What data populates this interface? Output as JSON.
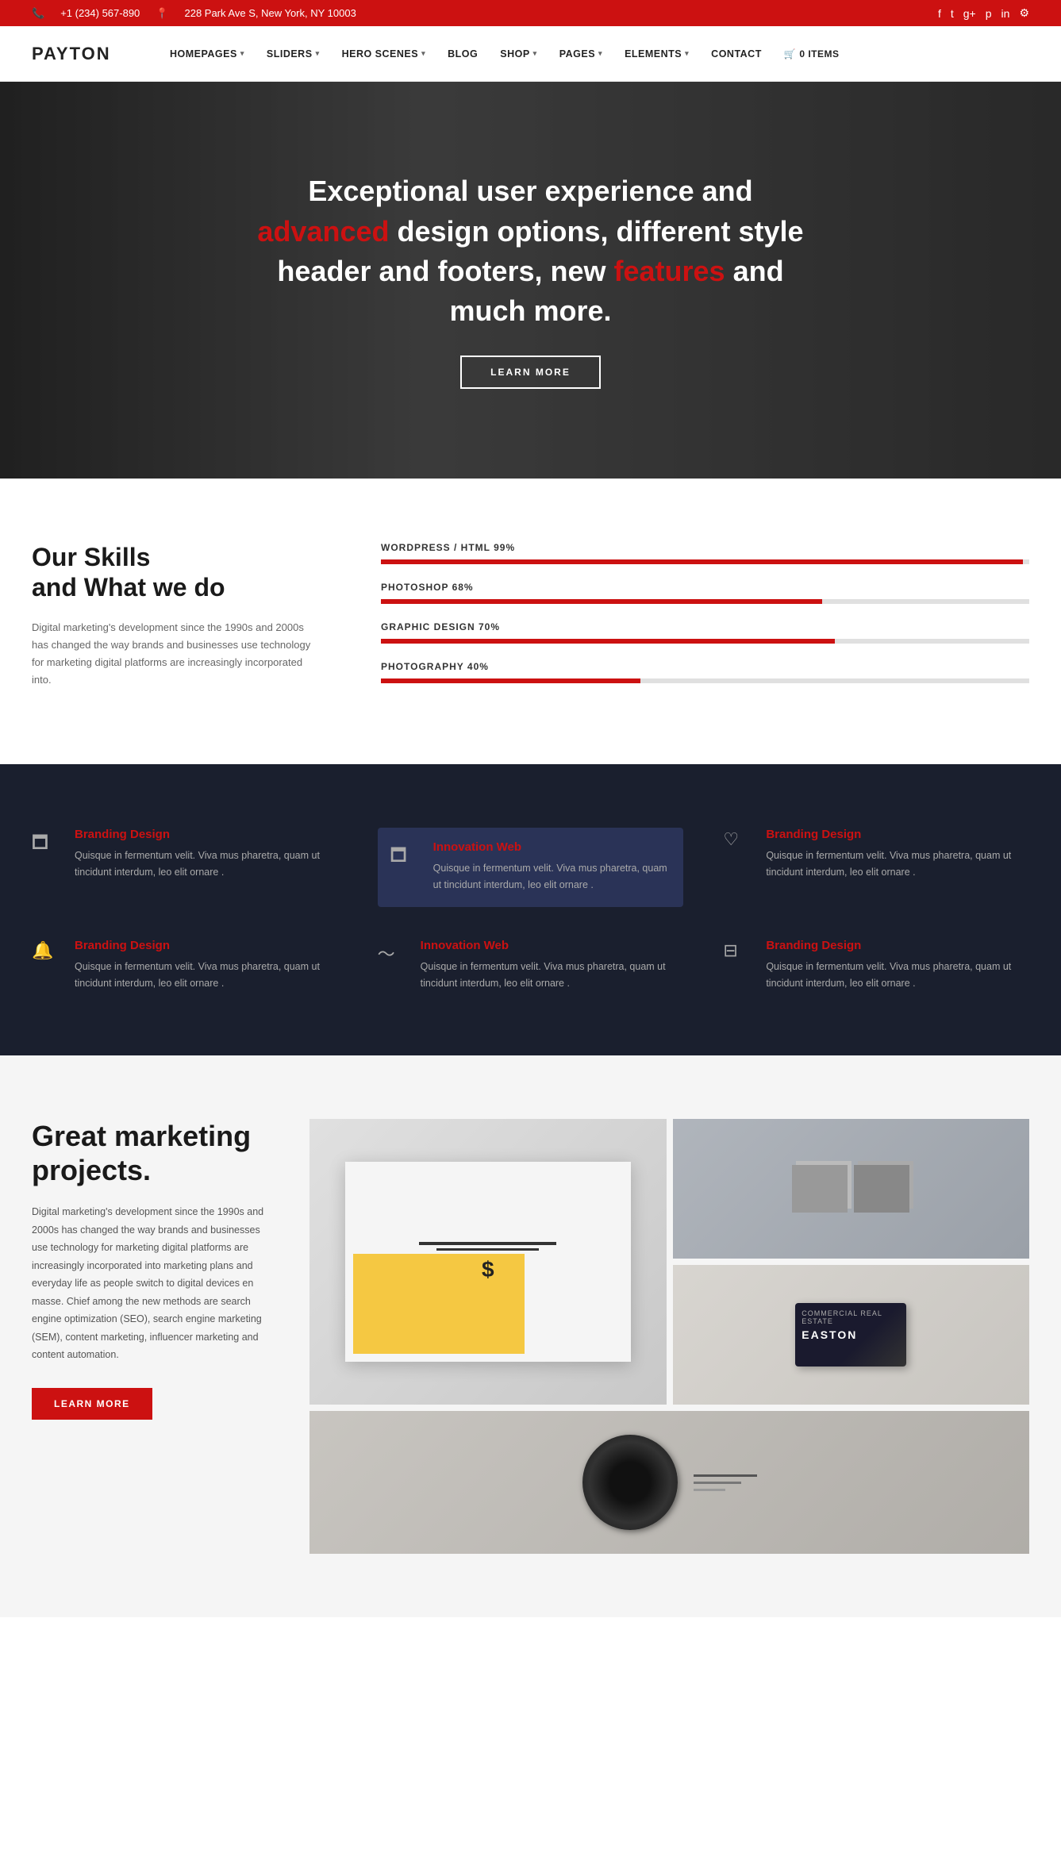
{
  "topbar": {
    "phone": "+1 (234) 567-890",
    "address": "228 Park Ave S, New York, NY 10003",
    "social": [
      "facebook",
      "twitter",
      "google-plus",
      "pinterest",
      "linkedin",
      "settings"
    ]
  },
  "navbar": {
    "logo": "PAYTON",
    "items": [
      {
        "label": "HOMEPAGES",
        "has_arrow": true
      },
      {
        "label": "SLIDERS",
        "has_arrow": true
      },
      {
        "label": "HERO SCENES",
        "has_arrow": true
      },
      {
        "label": "BLOG"
      },
      {
        "label": "SHOP",
        "has_arrow": true
      },
      {
        "label": "PAGES",
        "has_arrow": true
      },
      {
        "label": "ELEMENTS",
        "has_arrow": true
      },
      {
        "label": "CONTACT"
      }
    ],
    "cart_label": "0 ITEMS"
  },
  "hero": {
    "text_before": "Exceptional user experience and ",
    "text_accent1": "advanced",
    "text_middle": " design options, different style header and footers, new ",
    "text_accent2": "features",
    "text_after": " and much more.",
    "button_label": "LEARN MORE"
  },
  "skills": {
    "heading_line1": "Our Skills",
    "heading_line2": "and What we do",
    "description": "Digital marketing's development since the 1990s and 2000s has changed the way brands and businesses use technology for marketing digital platforms are increasingly incorporated into.",
    "items": [
      {
        "label": "WORDPRESS / HTML",
        "percent": 99
      },
      {
        "label": "PHOTOSHOP",
        "percent": 68
      },
      {
        "label": "GRAPHIC DESIGN",
        "percent": 70
      },
      {
        "label": "PHOTOGRAPHY",
        "percent": 40
      }
    ]
  },
  "services": {
    "items": [
      {
        "icon": "🗖",
        "title": "Branding Design",
        "description": "Quisque in fermentum velit. Viva mus pharetra, quam ut tincidunt interdum, leo elit ornare .",
        "highlighted": false
      },
      {
        "icon": "🗖",
        "title": "Innovation Web",
        "description": "Quisque in fermentum velit. Viva mus pharetra, quam ut tincidunt interdum, leo elit ornare .",
        "highlighted": true
      },
      {
        "icon": "♡",
        "title": "Branding Design",
        "description": "Quisque in fermentum velit. Viva mus pharetra, quam ut tincidunt interdum, leo elit ornare .",
        "highlighted": false
      },
      {
        "icon": "🔔",
        "title": "Branding Design",
        "description": "Quisque in fermentum velit. Viva mus pharetra, quam ut tincidunt interdum, leo elit ornare .",
        "highlighted": false
      },
      {
        "icon": "〜",
        "title": "Innovation Web",
        "description": "Quisque in fermentum velit. Viva mus pharetra, quam ut tincidunt interdum, leo elit ornare .",
        "highlighted": false
      },
      {
        "icon": "⊟",
        "title": "Branding Design",
        "description": "Quisque in fermentum velit. Viva mus pharetra, quam ut tincidunt interdum, leo elit ornare .",
        "highlighted": false
      }
    ]
  },
  "projects": {
    "heading_line1": "Great marketing",
    "heading_line2": "projects.",
    "description": "Digital marketing's development since the 1990s and 2000s has changed the way brands and businesses use technology for marketing digital platforms are increasingly incorporated into marketing plans and everyday life as people switch to digital devices en masse. Chief among the new methods are search engine optimization (SEO), search engine marketing (SEM), content marketing, influencer marketing and content automation.",
    "button_label": "LEARN MORE"
  }
}
